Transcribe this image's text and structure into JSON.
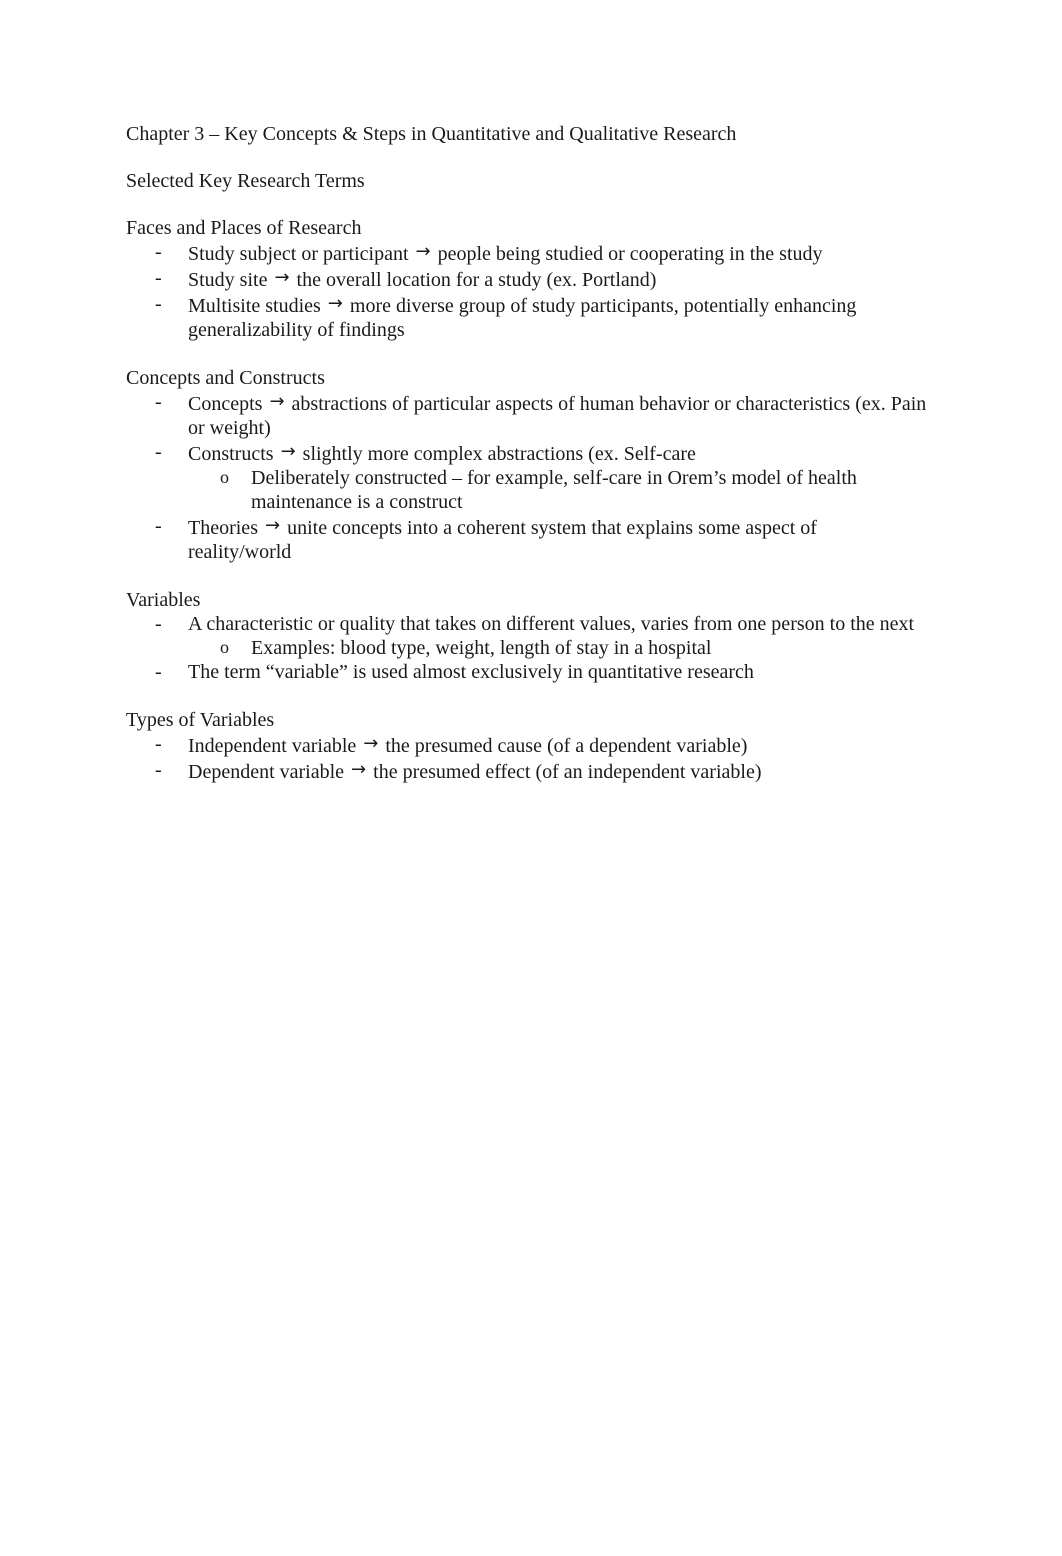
{
  "document": {
    "title": "Chapter 3 – Key Concepts & Steps in Quantitative and Qualitative Research",
    "subtitle": "Selected Key Research Terms",
    "arrow_icon": "→",
    "sections": [
      {
        "heading": "Faces and Places of Research",
        "items": [
          {
            "bullet": "-",
            "term": "Study subject or participant",
            "definition": "people being studied or cooperating in the study"
          },
          {
            "bullet": "-",
            "term": "Study site",
            "definition": "the overall location for a study (ex. Portland)"
          },
          {
            "bullet": "-",
            "term": "Multisite studies",
            "definition": "more diverse group of study participants, potentially enhancing generalizability of findings"
          }
        ]
      },
      {
        "heading": "Concepts and Constructs",
        "items": [
          {
            "bullet": "-",
            "term": "Concepts",
            "definition": "abstractions of particular aspects of human behavior or characteristics (ex. Pain or weight)"
          },
          {
            "bullet": "-",
            "term": "Constructs",
            "definition": "slightly more complex abstractions (ex. Self-care",
            "subitems": [
              {
                "bullet": "o",
                "text": "Deliberately constructed – for example, self-care in Orem’s model of health maintenance is a construct"
              }
            ]
          },
          {
            "bullet": "-",
            "term": "Theories",
            "definition": "unite concepts into a coherent system that explains some aspect of reality/world"
          }
        ]
      },
      {
        "heading": "Variables",
        "items": [
          {
            "bullet": "-",
            "text": "A characteristic or quality that takes on different values, varies from one person to the next",
            "subitems": [
              {
                "bullet": "o",
                "text": "Examples: blood type, weight, length of stay in a hospital"
              }
            ]
          },
          {
            "bullet": "-",
            "text": "The term “variable” is used almost exclusively in quantitative research"
          }
        ]
      },
      {
        "heading": "Types of Variables",
        "items": [
          {
            "bullet": "-",
            "term": "Independent variable",
            "definition": "the presumed cause (of a dependent variable)"
          },
          {
            "bullet": "-",
            "term": "Dependent variable",
            "definition": "the presumed effect (of an independent variable)"
          }
        ]
      }
    ]
  }
}
